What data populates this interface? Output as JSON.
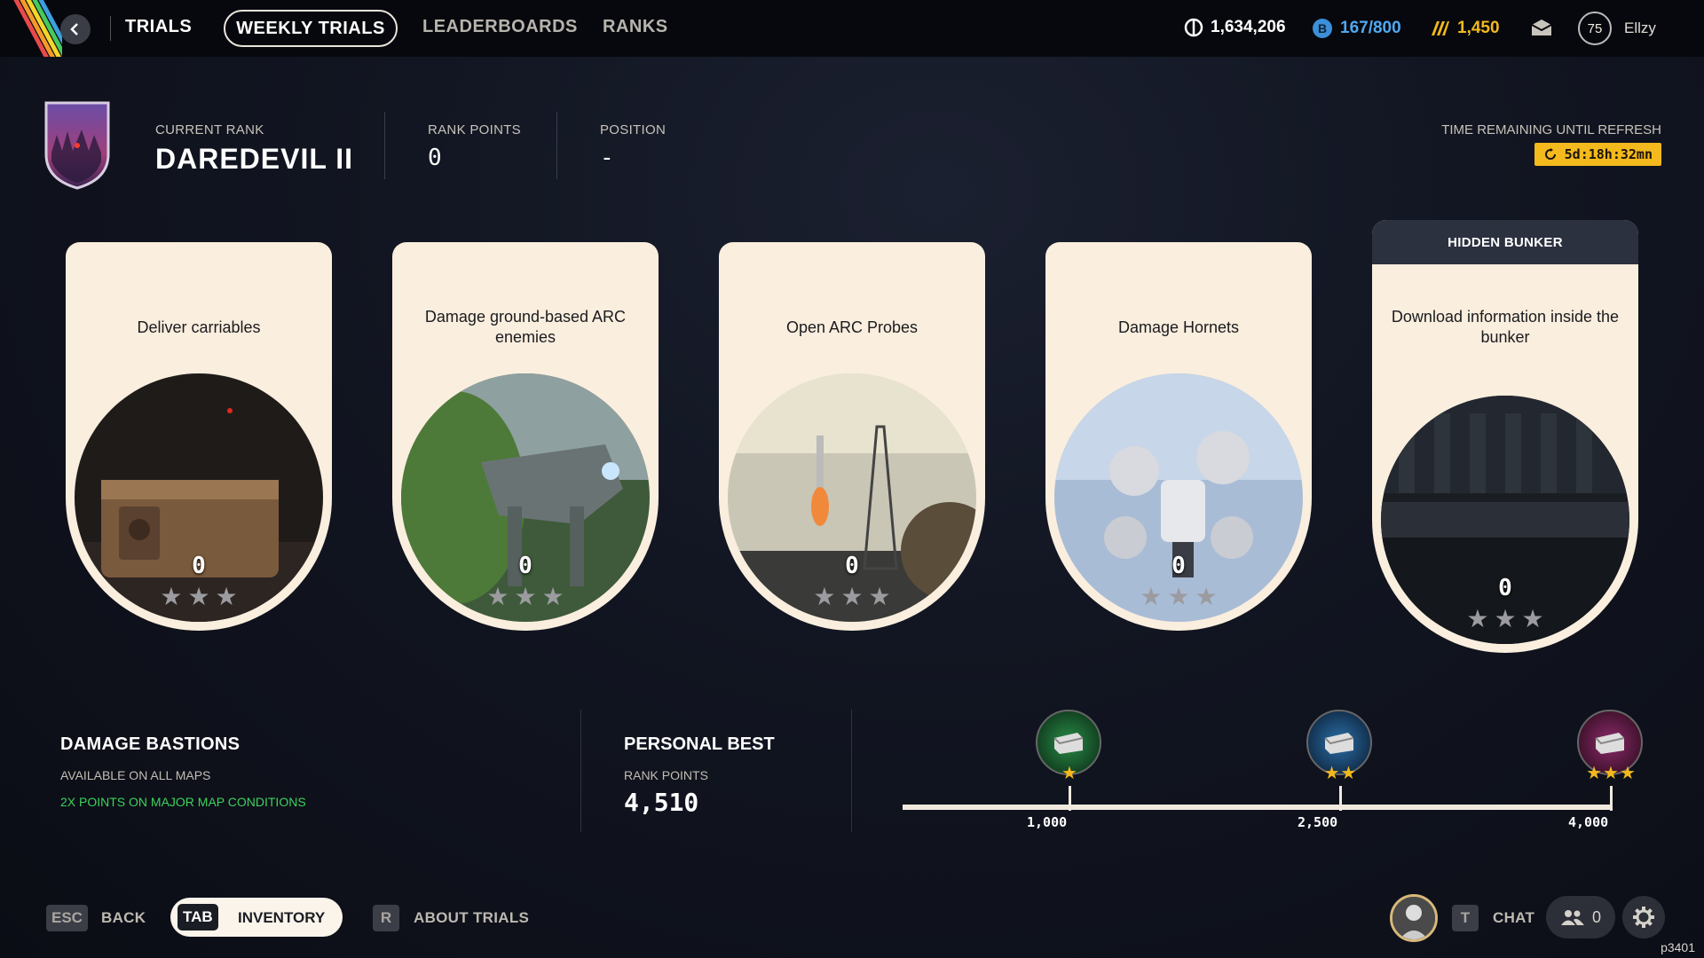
{
  "nav": {
    "trials": "TRIALS",
    "weekly_trials": "WEEKLY TRIALS",
    "leaderboards": "LEADERBOARDS",
    "ranks": "RANKS"
  },
  "currencies": {
    "coins": "1,634,206",
    "tokens": "167/800",
    "creds": "1,450"
  },
  "player": {
    "level": "75",
    "name": "Ellzy"
  },
  "rank": {
    "current_label": "CURRENT RANK",
    "current_value": "DAREDEVIL II",
    "points_label": "RANK POINTS",
    "points_value": "0",
    "position_label": "POSITION",
    "position_value": "-"
  },
  "refresh": {
    "label": "TIME REMAINING UNTIL REFRESH",
    "value": "5d:18h:32mn"
  },
  "cards": [
    {
      "title": "Deliver carriables",
      "score": "0",
      "stars": 3
    },
    {
      "title": "Damage ground-based ARC enemies",
      "score": "0",
      "stars": 3
    },
    {
      "title": "Open ARC Probes",
      "score": "0",
      "stars": 3
    },
    {
      "title": "Damage Hornets",
      "score": "0",
      "stars": 3
    },
    {
      "tag": "HIDDEN BUNKER",
      "title": "Download information inside the bunker",
      "score": "0",
      "stars": 3
    }
  ],
  "challenge": {
    "title": "DAMAGE BASTIONS",
    "subtitle": "AVAILABLE ON ALL MAPS",
    "bonus": "2X POINTS ON MAJOR MAP CONDITIONS"
  },
  "personal_best": {
    "title": "PERSONAL BEST",
    "label": "RANK POINTS",
    "value": "4,510"
  },
  "milestones": [
    {
      "value": "1,000",
      "stars": 1,
      "color": "#1e7a3a"
    },
    {
      "value": "2,500",
      "stars": 2,
      "color": "#1d5a8c"
    },
    {
      "value": "4,000",
      "stars": 3,
      "color": "#7a1e5e"
    }
  ],
  "footer": {
    "esc_key": "ESC",
    "back": "BACK",
    "tab_key": "TAB",
    "inventory": "INVENTORY",
    "r_key": "R",
    "about": "ABOUT TRIALS",
    "t_key": "T",
    "chat": "CHAT",
    "friends_count": "0",
    "build": "p3401"
  },
  "colors": {
    "accent_yellow": "#f3b91d",
    "card_bg": "#faeede",
    "bonus_green": "#3dd35c"
  }
}
